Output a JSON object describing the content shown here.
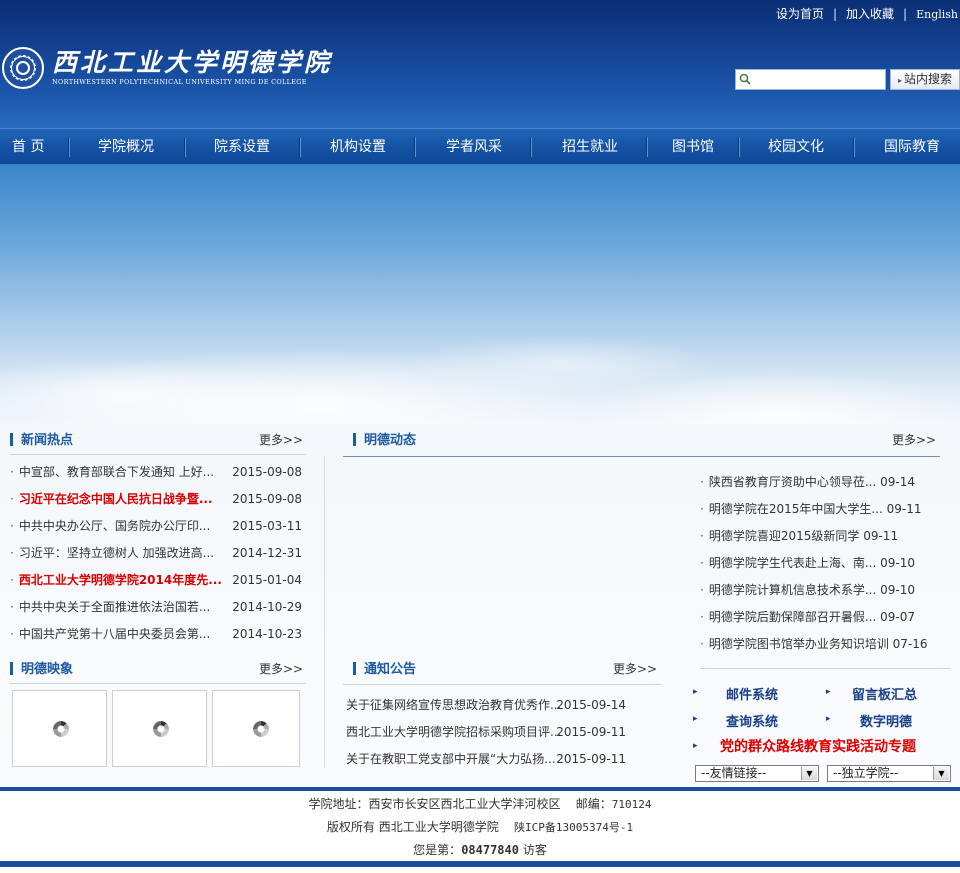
{
  "toplinks": {
    "home": "设为首页",
    "favorite": "加入收藏",
    "english": "English",
    "sep": "|"
  },
  "logo": {
    "cn": "西北工业大学明德学院",
    "en": "NORTHWESTERN POLYTECHNICAL UNIVERSITY MING DE COLLEGE"
  },
  "search": {
    "placeholder": "",
    "button": "站内搜索"
  },
  "nav": [
    "首 页",
    "学院概况",
    "院系设置",
    "机构设置",
    "学者风采",
    "招生就业",
    "图书馆",
    "校园文化",
    "国际教育"
  ],
  "news": {
    "title": "新闻热点",
    "more": "更多>>",
    "items": [
      {
        "text": "中宣部、教育部联合下发通知 上好...",
        "date": "2015-09-08",
        "highlight": false
      },
      {
        "text": "习近平在纪念中国人民抗日战争暨...",
        "date": "2015-09-08",
        "highlight": true
      },
      {
        "text": "中共中央办公厅、国务院办公厅印...",
        "date": "2015-03-11",
        "highlight": false
      },
      {
        "text": "习近平：坚持立德树人 加强改进高...",
        "date": "2014-12-31",
        "highlight": false
      },
      {
        "text": "西北工业大学明德学院2014年度先...",
        "date": "2015-01-04",
        "highlight": true
      },
      {
        "text": "中共中央关于全面推进依法治国若...",
        "date": "2014-10-29",
        "highlight": false
      },
      {
        "text": "中国共产党第十八届中央委员会第...",
        "date": "2014-10-23",
        "highlight": false
      }
    ]
  },
  "mingde_news": {
    "title": "明德动态",
    "more": "更多>>",
    "items": [
      {
        "text": "陕西省教育厅资助中心领导莅...",
        "date": "09-14"
      },
      {
        "text": "明德学院在2015年中国大学生...",
        "date": "09-11"
      },
      {
        "text": "明德学院喜迎2015级新同学",
        "date": "09-11"
      },
      {
        "text": "明德学院学生代表赴上海、南...",
        "date": "09-10"
      },
      {
        "text": "明德学院计算机信息技术系学...",
        "date": "09-10"
      },
      {
        "text": "明德学院后勤保障部召开暑假...",
        "date": "09-07"
      },
      {
        "text": "明德学院图书馆举办业务知识培训",
        "date": "07-16"
      }
    ]
  },
  "gallery": {
    "title": "明德映象",
    "more": "更多>>"
  },
  "notices": {
    "title": "通知公告",
    "more": "更多>>",
    "items": [
      {
        "text": "关于征集网络宣传思想政治教育优秀作...",
        "date": "2015-09-14"
      },
      {
        "text": "西北工业大学明德学院招标采购项目评...",
        "date": "2015-09-11"
      },
      {
        "text": "关于在教职工党支部中开展“大力弘扬...",
        "date": "2015-09-11"
      }
    ]
  },
  "quicklinks": {
    "mail": "邮件系统",
    "guestbook": "留言板汇总",
    "query": "查询系统",
    "digital": "数字明德",
    "party": "党的群众路线教育实践活动专题"
  },
  "selects": {
    "friend_links": "--友情链接--",
    "independent": "--独立学院--"
  },
  "footer": {
    "address_label": "学院地址：西安市长安区西北工业大学沣河校区",
    "postcode_label": "邮编：",
    "postcode": "710124",
    "copyright": "版权所有  西北工业大学明德学院",
    "icp": "陕ICP备13005374号-1",
    "visitor_prefix": "您是第：",
    "visitor_count": "08477840",
    "visitor_suffix": "访客"
  },
  "colors": {
    "brand_blue": "#1e5aa3",
    "nav_blue": "#1553a5",
    "highlight_red": "#d90000"
  }
}
